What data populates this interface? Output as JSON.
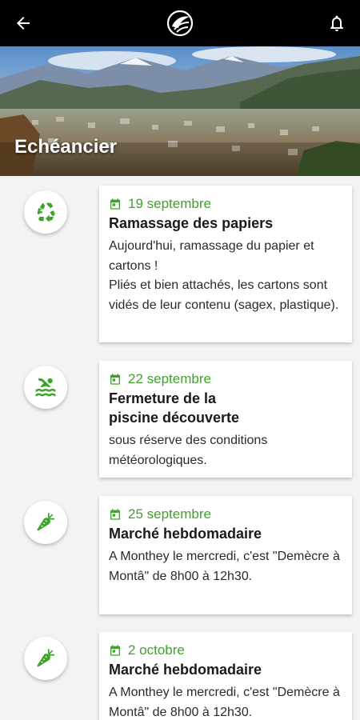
{
  "header": {
    "back_icon": "arrow-left-icon",
    "logo_icon": "app-logo-icon",
    "notification_icon": "bell-icon"
  },
  "hero": {
    "title": "Echéancier"
  },
  "colors": {
    "accent": "#3fa22a",
    "topbar": "#000000",
    "background": "#f3f3f3"
  },
  "events": [
    {
      "icon": "recycle-icon",
      "date": "19 septembre",
      "title": "Ramassage des papiers",
      "description": "Aujourd'hui, ramassage du papier et cartons !\nPliés et bien attachés, les cartons sont vidés de leur contenu (sagex, plastique)."
    },
    {
      "icon": "swimmer-icon",
      "date": "22 septembre",
      "title": "Fermeture de la piscine découverte",
      "description": "sous réserve des conditions météorologiques."
    },
    {
      "icon": "carrot-icon",
      "date": "25 septembre",
      "title": "Marché hebdomadaire",
      "description": "A Monthey le mercredi, c'est \"Demècre à Montâ\" de 8h00 à 12h30."
    },
    {
      "icon": "carrot-icon",
      "date": "2 octobre",
      "title": "Marché hebdomadaire",
      "description": "A Monthey le mercredi, c'est \"Demècre à Montâ\" de 8h00 à 12h30."
    }
  ]
}
